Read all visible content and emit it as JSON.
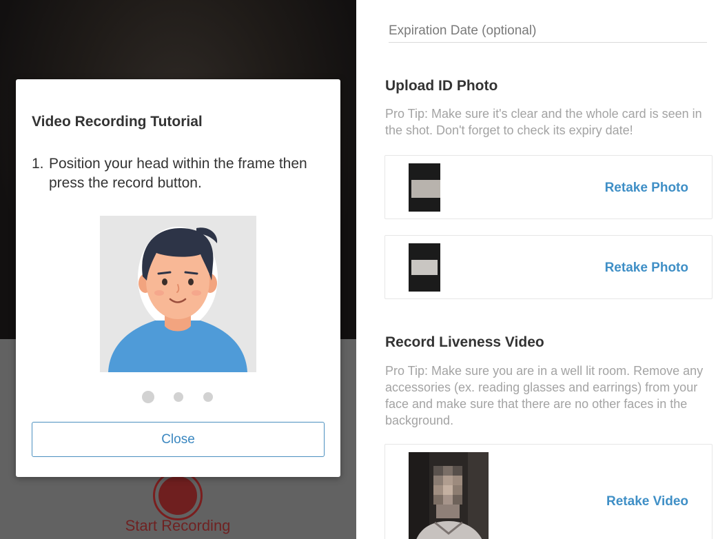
{
  "camera": {
    "start_recording_label": "Start Recording"
  },
  "modal": {
    "title": "Video Recording Tutorial",
    "step_number": "1.",
    "step_text": "Position your head within the frame then press the record button.",
    "pagination": {
      "total": 3,
      "active_index": 0
    },
    "close_label": "Close"
  },
  "form": {
    "expiration_placeholder": "Expiration Date (optional)",
    "id_section": {
      "title": "Upload ID Photo",
      "tip_label": "Pro Tip:",
      "tip_text": " Make sure it's clear and the whole card is seen in the shot. Don't forget to check its expiry date!",
      "photos": [
        {
          "action_label": "Retake Photo"
        },
        {
          "action_label": "Retake Photo"
        }
      ]
    },
    "video_section": {
      "title": "Record Liveness Video",
      "tip_label": "Pro Tip:",
      "tip_text": " Make sure you are in a well lit room. Remove any accessories (ex. reading glasses and earrings) from your face and make sure that there are no other faces in the background.",
      "action_label": "Retake Video"
    }
  },
  "colors": {
    "accent_blue": "#3f8fc6",
    "record_red": "#6f1f1f",
    "tip_gray": "#a3a3a3"
  }
}
